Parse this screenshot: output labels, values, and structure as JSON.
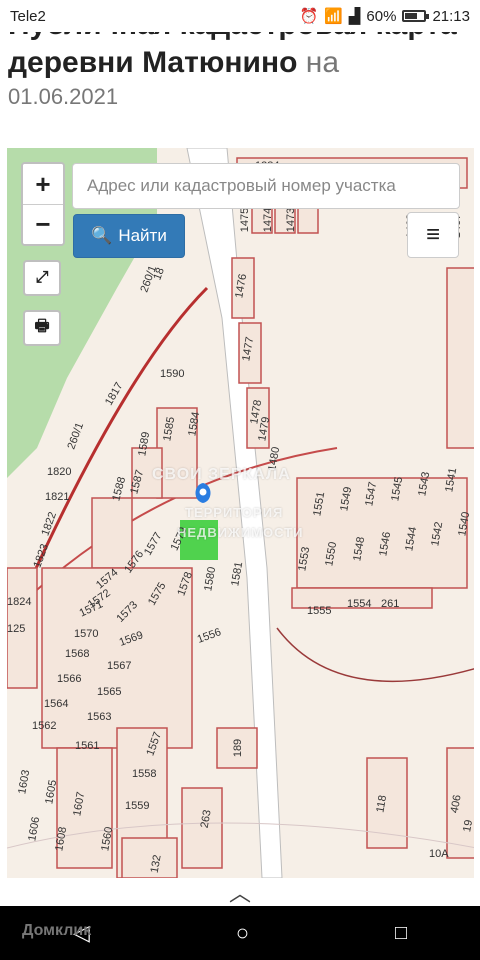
{
  "status": {
    "carrier": "Tele2",
    "battery_text": "60%",
    "battery_level": 0.6,
    "time": "21:13"
  },
  "page": {
    "title": "Публичная кадастровая карта деревни Матюнино",
    "title_suffix": "на",
    "date": "01.06.2021"
  },
  "map": {
    "zoom_in_label": "+",
    "zoom_out_label": "−",
    "search_placeholder": "Адрес или кадастровый номер участка",
    "search_button_label": "Найти",
    "watermark_lines": [
      "СВОИ ЗЕРКАЛА",
      "ТЕРРИТОРИЯ",
      "НЕДВИЖИМОСТИ"
    ],
    "plots": [
      "1384",
      "1475",
      "1474",
      "1473",
      "1468",
      "1467",
      "1476",
      "1477",
      "1478",
      "1479",
      "1480",
      "260/1",
      "18",
      "1817",
      "1590",
      "1589",
      "1585",
      "1584",
      "1820",
      "1821",
      "1822",
      "1823",
      "260/1",
      "1588",
      "1587",
      "1551",
      "1549",
      "1547",
      "1545",
      "1543",
      "1541",
      "1540",
      "1542",
      "1544",
      "1546",
      "1548",
      "1550",
      "1553",
      "1577",
      "1576",
      "1579",
      "1574",
      "1580",
      "1581",
      "1575",
      "1578",
      "1573",
      "1572",
      "1571",
      "1570",
      "1569",
      "1568",
      "1567",
      "1566",
      "1565",
      "1564",
      "1563",
      "1562",
      "1561",
      "1555",
      "1554",
      "261",
      "1556",
      "1824",
      "125",
      "1603",
      "1605",
      "1607",
      "1606",
      "1608",
      "1557",
      "1558",
      "1559",
      "1560",
      "189",
      "263",
      "118",
      "406",
      "132",
      "10А",
      "19"
    ]
  },
  "bottom": {
    "chevron": "︿",
    "ghost_app": "Домклик"
  }
}
